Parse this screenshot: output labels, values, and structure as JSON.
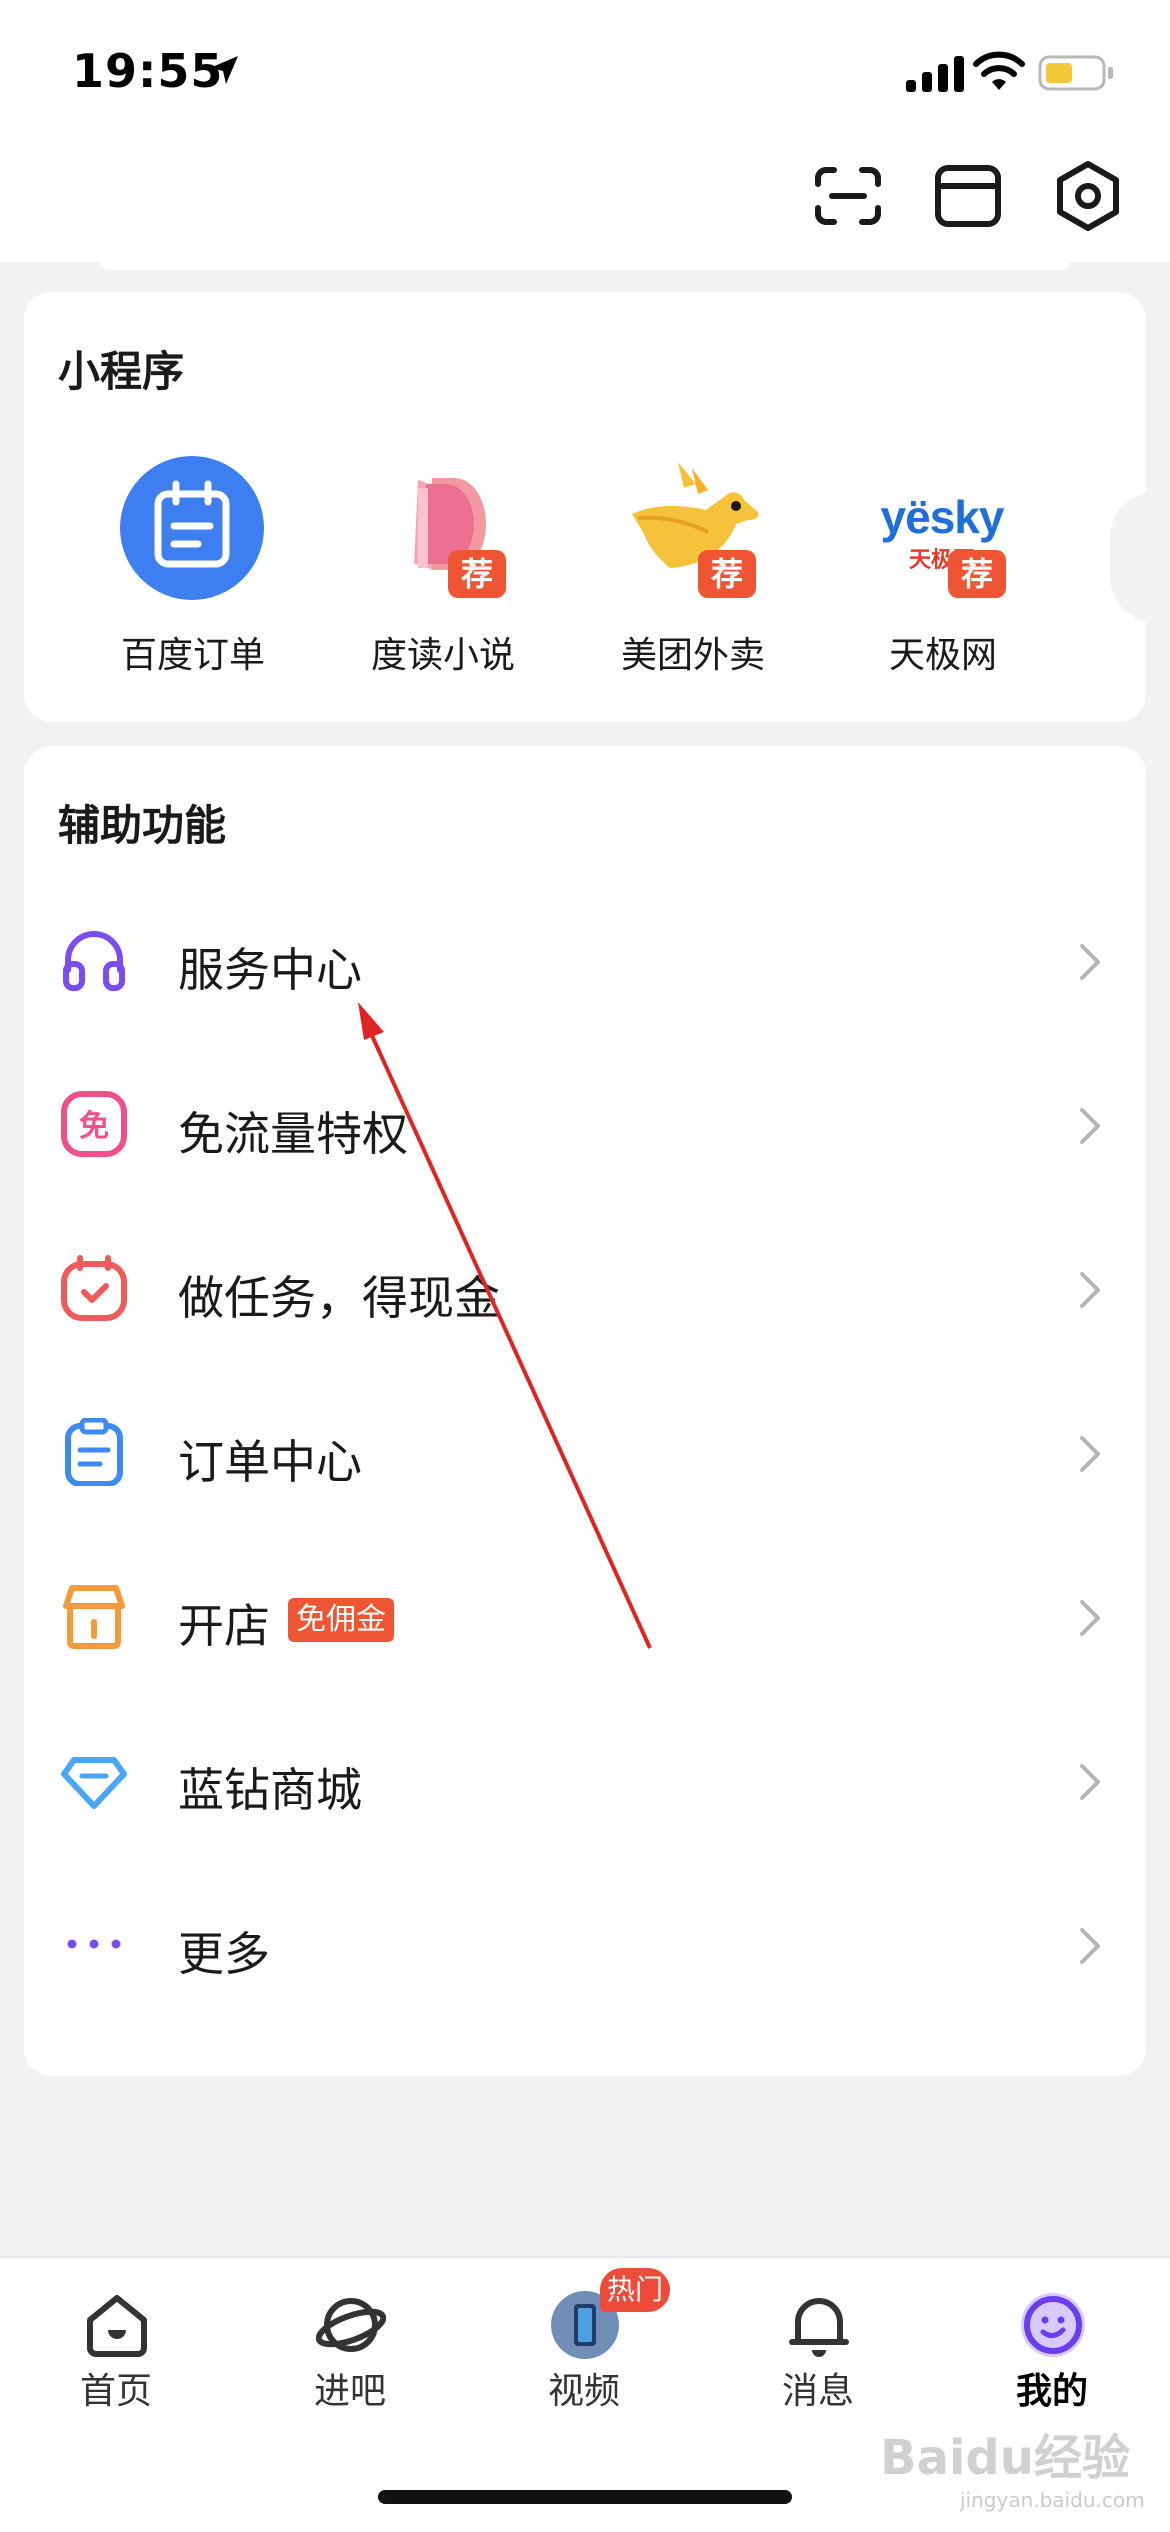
{
  "status_bar": {
    "time": "19:55"
  },
  "mini_programs": {
    "title": "小程序",
    "items": [
      {
        "label": "百度订单",
        "icon": "calendar-icon"
      },
      {
        "label": "度读小说",
        "icon": "book-icon",
        "badge": "荐"
      },
      {
        "label": "美团外卖",
        "icon": "kangaroo-icon",
        "badge": "荐"
      },
      {
        "label": "天极网",
        "icon": "yesky-logo-icon",
        "badge": "荐",
        "logo_text": "yësky",
        "logo_sub": "天极网"
      }
    ]
  },
  "aux": {
    "title": "辅助功能",
    "rows": [
      {
        "label": "服务中心",
        "icon": "headphones-icon",
        "color": "#7b4df0"
      },
      {
        "label": "免流量特权",
        "icon": "free-data-icon",
        "color": "#f0508a",
        "icon_text": "免"
      },
      {
        "label": "做任务，得现金",
        "icon": "task-clock-icon",
        "color": "#ef5a5a"
      },
      {
        "label": "订单中心",
        "icon": "clipboard-icon",
        "color": "#3d8bf0"
      },
      {
        "label": "开店",
        "icon": "store-icon",
        "color": "#f59a3a",
        "badge": "免佣金"
      },
      {
        "label": "蓝钻商城",
        "icon": "diamond-icon",
        "color": "#4aa6f5"
      },
      {
        "label": "更多",
        "icon": "more-dots-icon",
        "color": "#7b4df0"
      }
    ]
  },
  "tabbar": {
    "tabs": [
      {
        "label": "首页",
        "icon": "home-icon"
      },
      {
        "label": "进吧",
        "icon": "planet-icon"
      },
      {
        "label": "视频",
        "icon": "video-avatar-icon",
        "badge": "热门"
      },
      {
        "label": "消息",
        "icon": "bell-icon"
      },
      {
        "label": "我的",
        "icon": "smiley-icon",
        "active": true
      }
    ]
  },
  "watermark": {
    "text": "Baidu经验",
    "sub": "jingyan.baidu.com"
  },
  "colors": {
    "accent_blue": "#3d7ef0",
    "badge_red": "#ef5532",
    "purple": "#7b4df0"
  }
}
